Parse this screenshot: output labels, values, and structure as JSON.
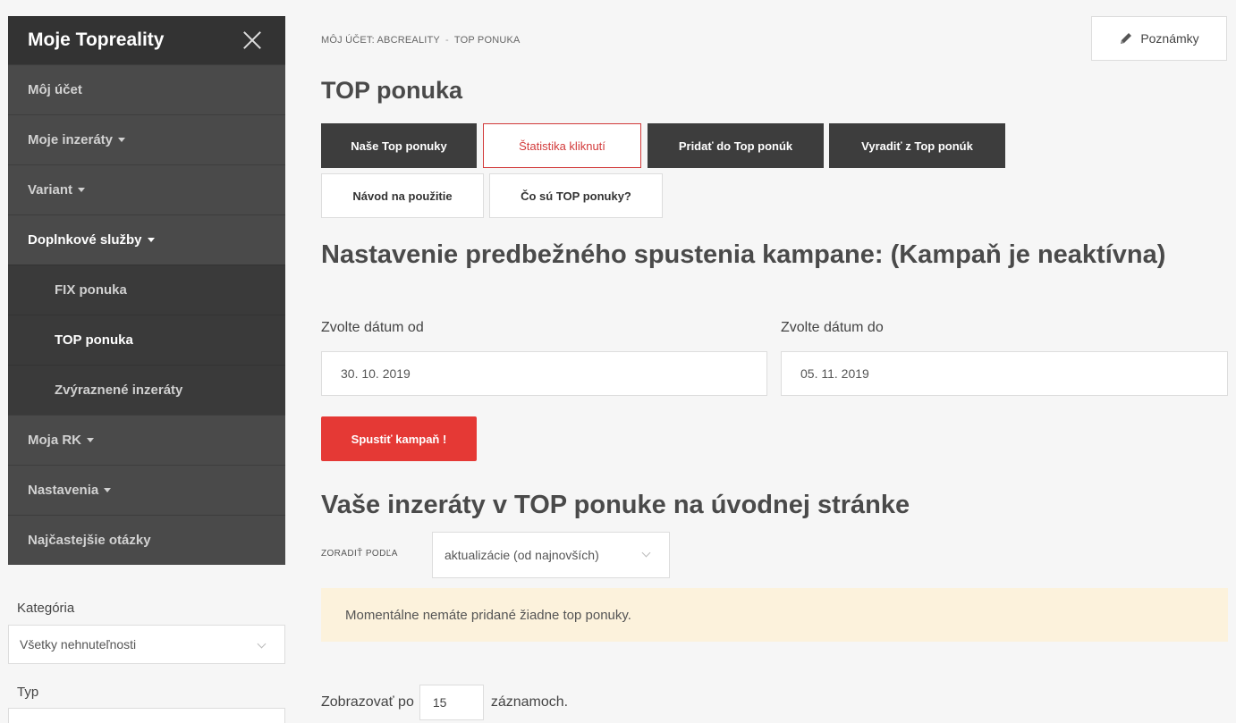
{
  "sidebar": {
    "title": "Moje Topreality",
    "items": [
      {
        "label": "Môj účet"
      },
      {
        "label": "Moje inzeráty"
      },
      {
        "label": "Variant"
      },
      {
        "label": "Doplnkové služby"
      },
      {
        "label": "FIX ponuka"
      },
      {
        "label": "TOP ponuka"
      },
      {
        "label": "Zvýraznené inzeráty"
      },
      {
        "label": "Moja RK"
      },
      {
        "label": "Nastavenia"
      },
      {
        "label": "Najčastejšie otázky"
      }
    ]
  },
  "filters": {
    "category_label": "Kategória",
    "category_value": "Všetky nehnuteľnosti",
    "type_label": "Typ"
  },
  "breadcrumb": [
    "MÔJ ÚČET: ABCREALITY",
    "TOP PONUKA"
  ],
  "notes_label": "Poznámky",
  "page_title": "TOP ponuka",
  "tabs": [
    {
      "label": "Naše Top ponuky"
    },
    {
      "label": "Štatistika kliknutí"
    },
    {
      "label": "Pridať do Top ponúk"
    },
    {
      "label": "Vyradiť z Top ponúk"
    },
    {
      "label": "Návod na použitie"
    },
    {
      "label": "Čo sú TOP ponuky?"
    }
  ],
  "campaign": {
    "title": "Nastavenie predbežného spustenia kampane: (Kampaň je neaktívna)",
    "from_label": "Zvolte dátum od",
    "from_value": "30. 10. 2019",
    "to_label": "Zvolte dátum do",
    "to_value": "05. 11. 2019",
    "start_label": "Spustiť kampaň !"
  },
  "listing": {
    "title": "Vaše inzeráty v TOP ponuke na úvodnej stránke",
    "sort_label": "ZORADIŤ PODĽA",
    "sort_value": "aktualizácie (od najnovších)",
    "empty_message": "Momentálne nemáte pridané žiadne top ponuky.",
    "per_page_prefix": "Zobrazovať po",
    "per_page_value": "15",
    "per_page_suffix": "záznamoch."
  },
  "colors": {
    "sidebar_bg": "#4a4a4a",
    "sidebar_header_bg": "#333333",
    "accent_red": "#e53935",
    "alert_bg": "#fcf2dc"
  }
}
